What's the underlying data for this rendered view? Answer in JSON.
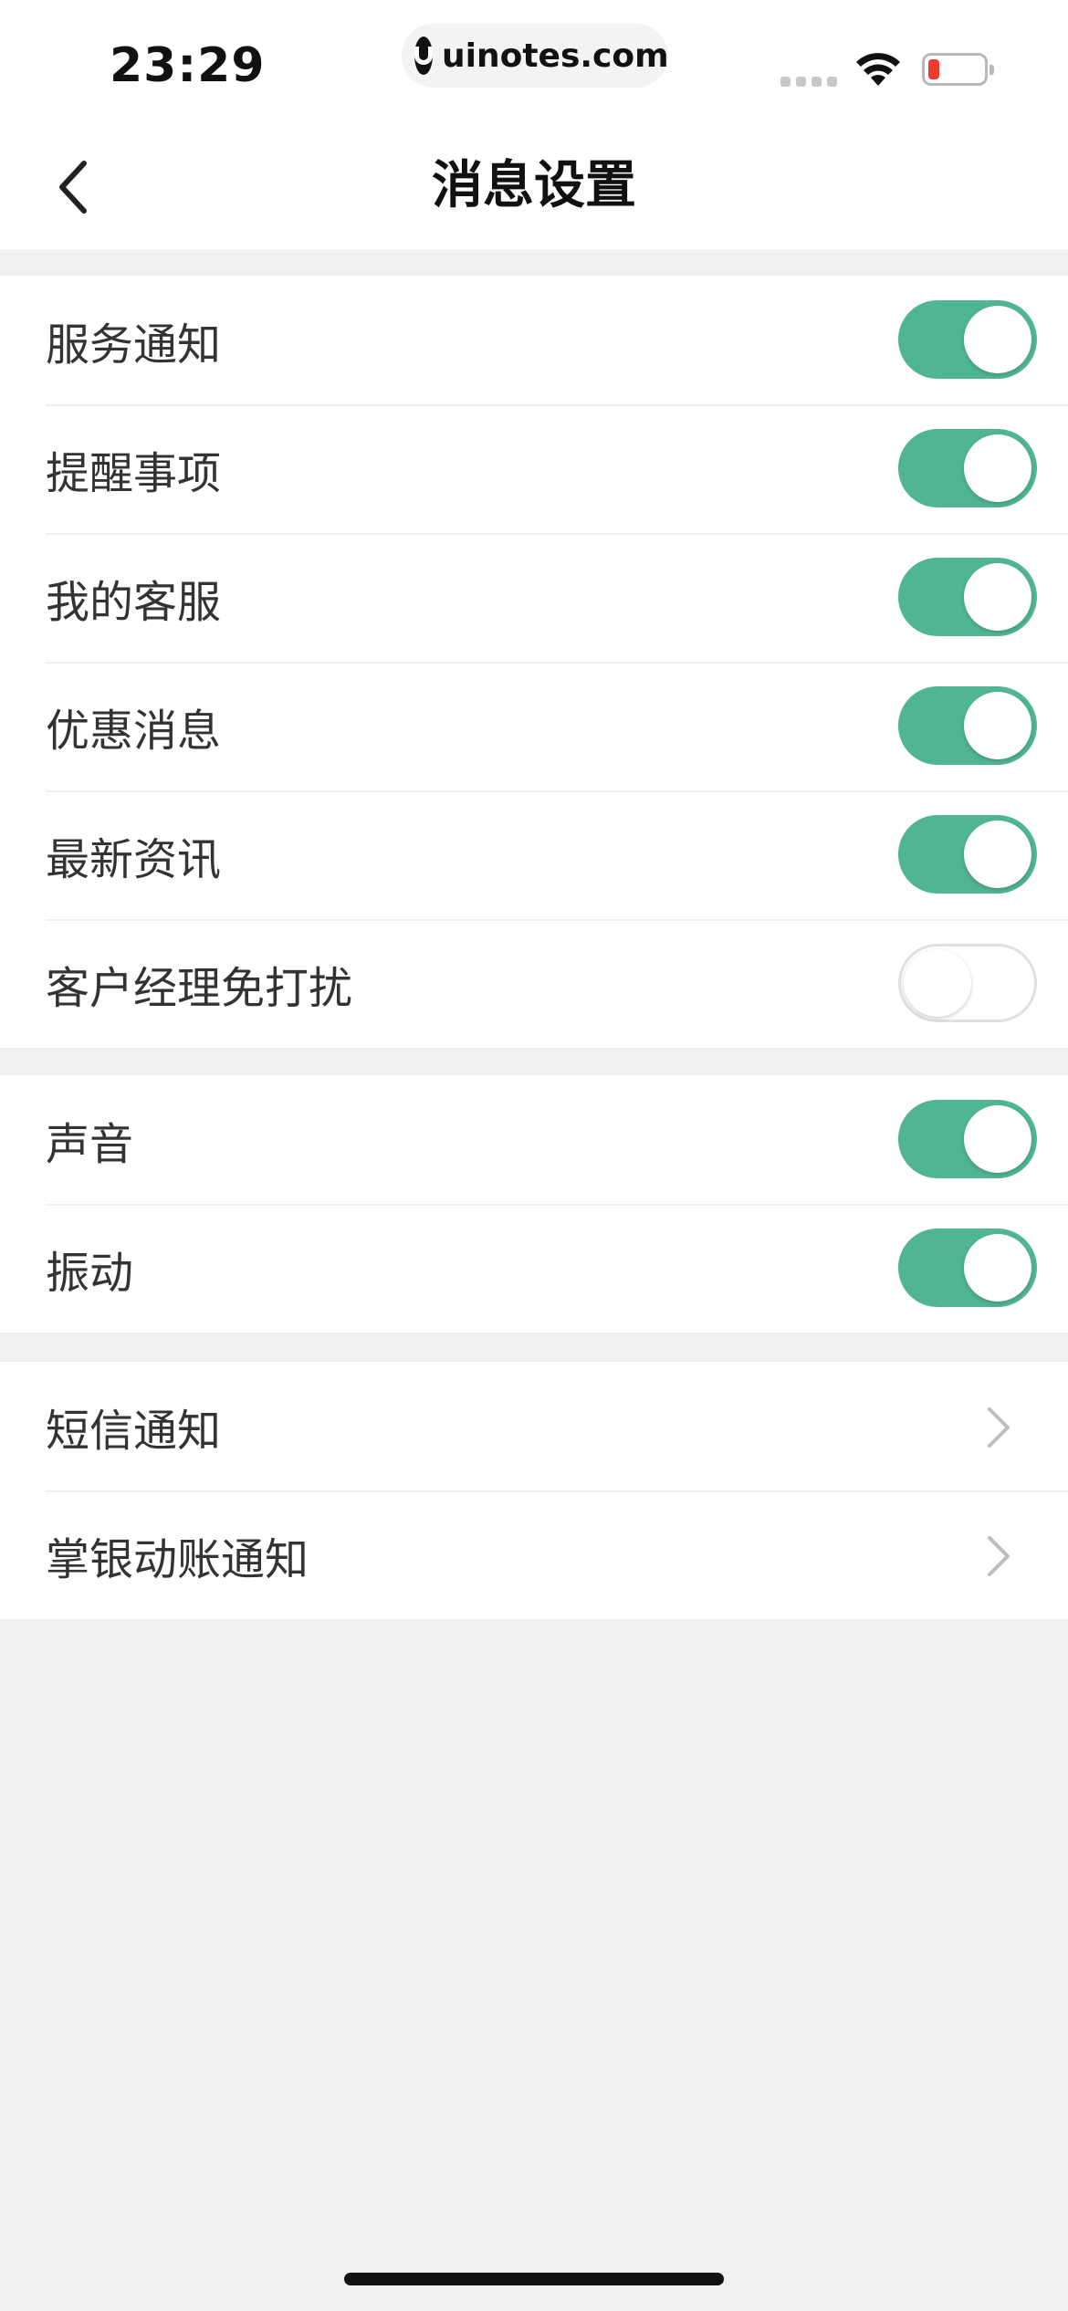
{
  "status_bar": {
    "time": "23:29",
    "site": "uinotes.com",
    "battery_color": "#ee3b2f"
  },
  "nav": {
    "back_icon": "chevron-left-icon",
    "title": "消息设置"
  },
  "colors": {
    "toggle_on": "#50b592",
    "toggle_off_border": "#e0e0e0",
    "background": "#f0f0f0"
  },
  "section_notifications": {
    "items": [
      {
        "label": "服务通知",
        "enabled": true
      },
      {
        "label": "提醒事项",
        "enabled": true
      },
      {
        "label": "我的客服",
        "enabled": true
      },
      {
        "label": "优惠消息",
        "enabled": true
      },
      {
        "label": "最新资讯",
        "enabled": true
      },
      {
        "label": "客户经理免打扰",
        "enabled": false
      }
    ]
  },
  "section_alerts": {
    "items": [
      {
        "label": "声音",
        "enabled": true
      },
      {
        "label": "振动",
        "enabled": true
      }
    ]
  },
  "section_links": {
    "items": [
      {
        "label": "短信通知",
        "icon": "chevron-right-icon"
      },
      {
        "label": "掌银动账通知",
        "icon": "chevron-right-icon"
      }
    ]
  }
}
